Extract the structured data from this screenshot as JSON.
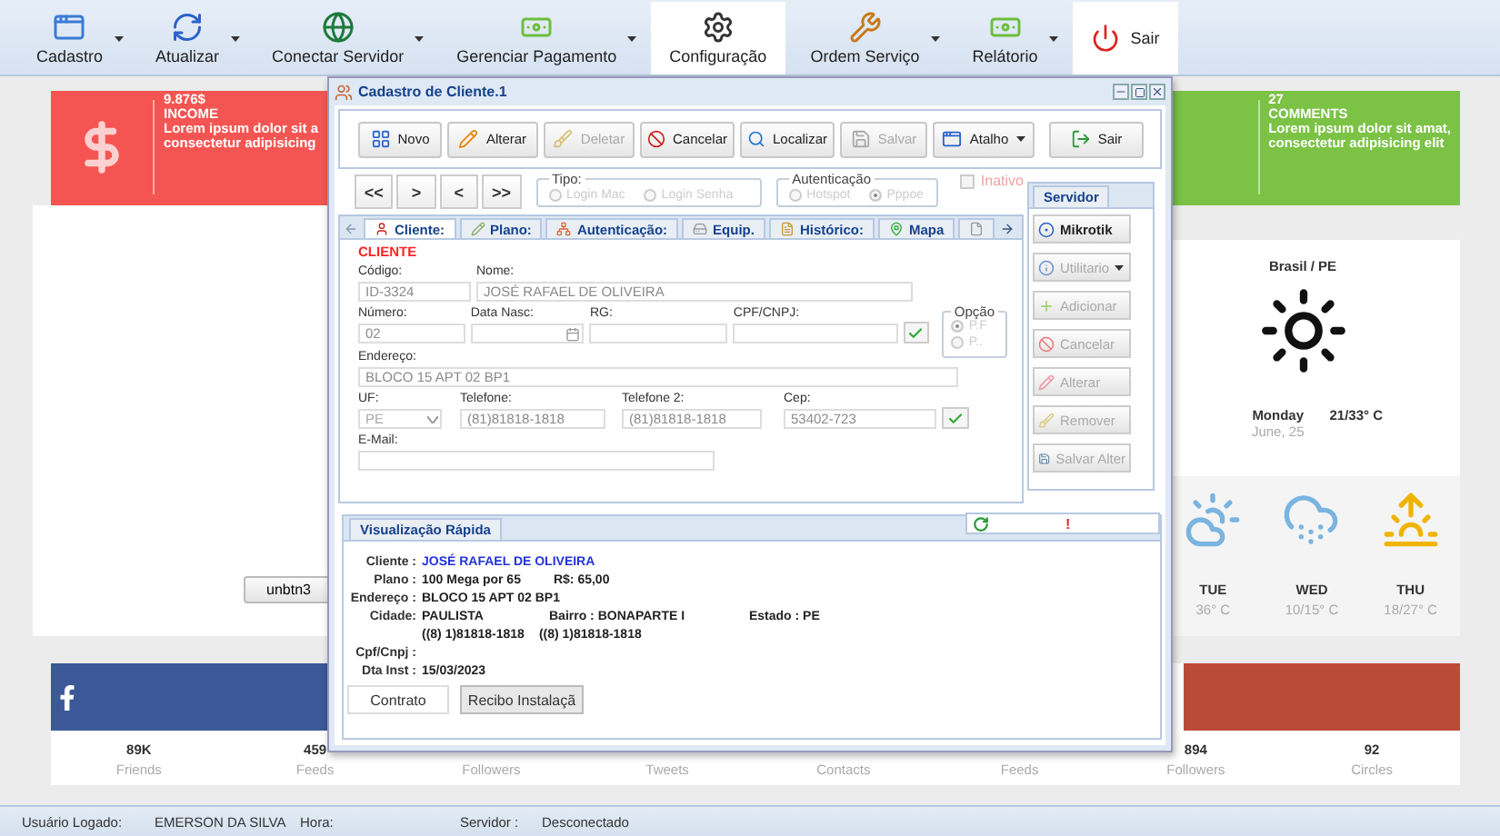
{
  "toolbar": [
    {
      "label": "Cadastro",
      "kind": "menu",
      "dropdown": true,
      "highlighted": false
    },
    {
      "label": "Atualizar",
      "kind": "menu",
      "dropdown": true,
      "highlighted": false
    },
    {
      "label": "Conectar Servidor",
      "kind": "menu",
      "dropdown": true,
      "highlighted": false
    },
    {
      "label": "Gerenciar Pagamento",
      "kind": "menu",
      "dropdown": true,
      "highlighted": false
    },
    {
      "label": "Configuração",
      "kind": "menu",
      "dropdown": false,
      "highlighted": true
    },
    {
      "label": "Ordem Serviço",
      "kind": "menu",
      "dropdown": true,
      "highlighted": false
    },
    {
      "label": "Relátorio",
      "kind": "menu",
      "dropdown": true,
      "highlighted": false
    },
    {
      "label": "Sair",
      "kind": "exit",
      "dropdown": false,
      "highlighted": true
    }
  ],
  "dashboard": {
    "income_card": {
      "value": "9.876$",
      "title": "INCOME",
      "lines": [
        "Lorem ipsum dolor sit a",
        "consectetur adipisicing"
      ]
    },
    "comments_card": {
      "value": "27",
      "title": "COMMENTS",
      "lines": [
        "Lorem ipsum dolor sit amat,",
        "consectetur adipisicing elit"
      ]
    },
    "left_panel": {
      "button": "unbtn3"
    },
    "weather": {
      "location": "Brasil / PE",
      "day": "Monday",
      "date": "June, 25",
      "temperature": "21/33° C",
      "forecast": [
        {
          "day": "TUE",
          "temperature": "36° C"
        },
        {
          "day": "WED",
          "temperature": "10/15° C"
        },
        {
          "day": "THU",
          "temperature": "18/27° C"
        }
      ]
    },
    "social": [
      {
        "value": "89K",
        "label": "Friends"
      },
      {
        "value": "459",
        "label": "Feeds"
      },
      {
        "label": "Followers"
      },
      {
        "label": "Tweets"
      },
      {
        "label": "Contacts"
      },
      {
        "label": "Feeds"
      },
      {
        "value": "894",
        "label": "Followers"
      },
      {
        "value": "92",
        "label": "Circles"
      }
    ]
  },
  "dialog": {
    "title": "Cadastro de Cliente.1",
    "buttons": [
      {
        "label": "Novo",
        "disabled": false,
        "dropdown": false
      },
      {
        "label": "Alterar",
        "disabled": false,
        "dropdown": false
      },
      {
        "label": "Deletar",
        "disabled": true,
        "dropdown": false
      },
      {
        "label": "Cancelar",
        "disabled": false,
        "dropdown": false
      },
      {
        "label": "Localizar",
        "disabled": false,
        "dropdown": false
      },
      {
        "label": "Salvar",
        "disabled": true,
        "dropdown": false
      },
      {
        "label": "Atalho",
        "disabled": false,
        "dropdown": true
      },
      {
        "label": "Sair",
        "disabled": false,
        "dropdown": false
      }
    ],
    "nav": [
      "<<",
      ">",
      "<",
      ">>"
    ],
    "groups": [
      {
        "legend": "Tipo:",
        "options": [
          {
            "label": "Login Mac",
            "selected": false
          },
          {
            "label": "Login Senha",
            "selected": false
          }
        ]
      },
      {
        "legend": "Autenticação",
        "options": [
          {
            "label": "Hotspot",
            "selected": false
          },
          {
            "label": "Pppoe",
            "selected": true
          }
        ]
      }
    ],
    "inativo": {
      "label": "Inativo",
      "checked": false
    },
    "tabs": [
      {
        "label": "Cliente:",
        "selected": true
      },
      {
        "label": "Plano:",
        "selected": false
      },
      {
        "label": "Autenticação:",
        "selected": false
      },
      {
        "label": "Equip.",
        "selected": false
      },
      {
        "label": "Histórico:",
        "selected": false
      },
      {
        "label": "Mapa",
        "selected": false
      }
    ],
    "section": "CLIENTE",
    "fields": {
      "codigo": {
        "label": "Código:",
        "value": "ID-3324"
      },
      "nome": {
        "label": "Nome:",
        "value": "JOSÉ RAFAEL DE OLIVEIRA"
      },
      "numero": {
        "label": "Número:",
        "value": "02"
      },
      "data_nasc": {
        "label": "Data Nasc:"
      },
      "rg": {
        "label": "RG:"
      },
      "cpf": {
        "label": "CPF/CNPJ:"
      },
      "endereco": {
        "label": "Endereço:",
        "value": "BLOCO 15 APT 02 BP1"
      },
      "uf": {
        "label": "UF:",
        "value": "PE"
      },
      "telefone": {
        "label": "Telefone:",
        "value": "(81)81818-1818"
      },
      "telefone2": {
        "label": "Telefone 2:",
        "value": "(81)81818-1818"
      },
      "cep": {
        "label": "Cep:",
        "value": "53402-723"
      },
      "email": {
        "label": "E-Mail:"
      }
    },
    "opcao": {
      "legend": "Opção",
      "options": [
        {
          "label": "P.F",
          "selected": true
        },
        {
          "label": "P..",
          "selected": false
        }
      ]
    },
    "server_panel": {
      "tab": "Servidor",
      "buttons": [
        {
          "label": "Mikrotik",
          "disabled": false,
          "dropdown": false
        },
        {
          "label": "Utilitario",
          "disabled": true,
          "dropdown": true
        },
        {
          "label": "Adicionar",
          "disabled": true,
          "dropdown": false
        },
        {
          "label": "Cancelar",
          "disabled": true,
          "dropdown": false
        },
        {
          "label": "Alterar",
          "disabled": true,
          "dropdown": false
        },
        {
          "label": "Remover",
          "disabled": true,
          "dropdown": false
        },
        {
          "label": "Salvar Alter",
          "disabled": true,
          "dropdown": false
        }
      ]
    },
    "quick_view": {
      "tab": "Visualização Rápida",
      "alert": "!",
      "cliente_label": "Cliente :",
      "cliente": "JOSÉ RAFAEL DE OLIVEIRA",
      "plano_label": "Plano :",
      "plano": "100 Mega por 65",
      "preco": "R$: 65,00",
      "endereco_label": "Endereço :",
      "endereco": "BLOCO 15 APT 02 BP1",
      "cidade_label": "Cidade:",
      "cidade": "PAULISTA",
      "bairro": "Bairro : BONAPARTE I",
      "estado": "Estado : PE",
      "telefones": [
        "((8) 1)81818-1818",
        "((8) 1)81818-1818"
      ],
      "cpf_label": "Cpf/Cnpj :",
      "dta_label": "Dta Inst :",
      "dta": "15/03/2023",
      "buttons": [
        "Contrato",
        "Recibo Instalaçã"
      ]
    }
  },
  "status_bar": {
    "user_label": "Usuário Logado:",
    "user": "EMERSON DA SILVA",
    "time_label": "Hora:",
    "server_label": "Servidor :",
    "server": "Desconectado"
  }
}
